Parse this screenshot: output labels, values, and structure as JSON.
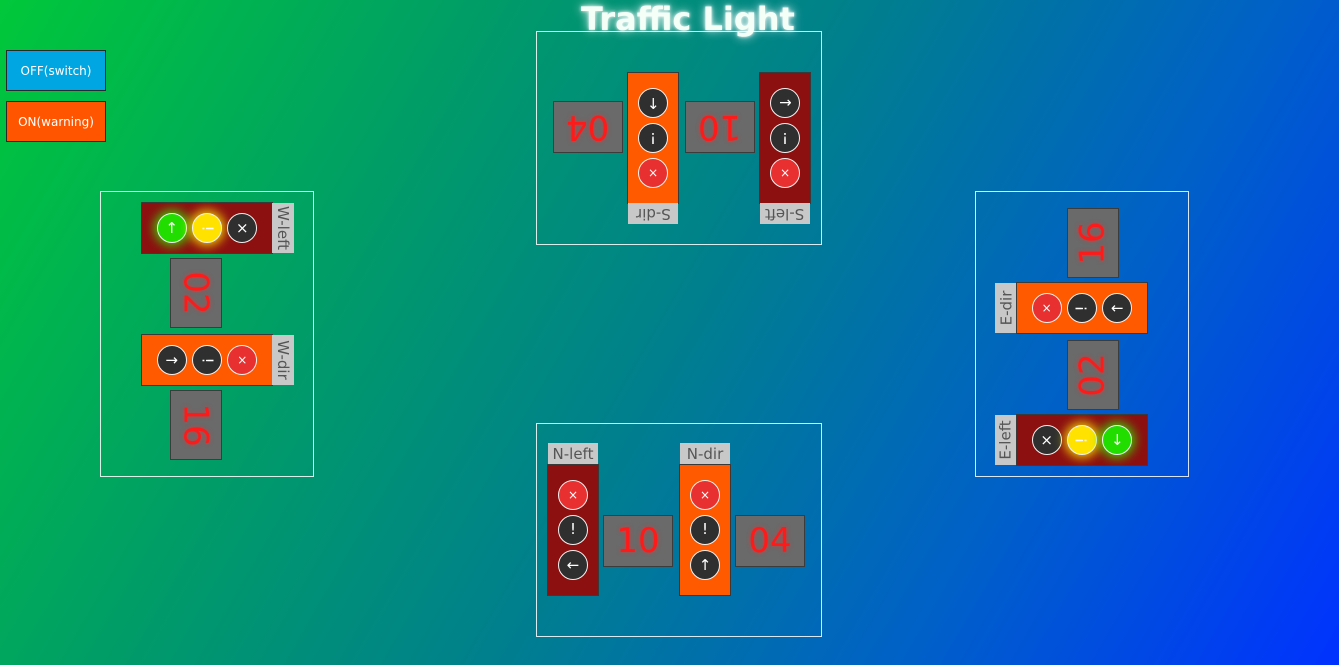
{
  "title": "Traffic Light",
  "controls": {
    "off_label": "OFF(switch)",
    "on_label": "ON(warning)"
  },
  "colors": {
    "background_start": "#00c83a",
    "background_end": "#0032ff",
    "housing_dark": "#8c1010",
    "housing_orange": "#ff5a00",
    "lamp_red": "#e83030",
    "lamp_yellow": "#ffe200",
    "lamp_green": "#22dd00",
    "counter_text": "#ff1a1a",
    "button_off": "#00a6e2",
    "button_on": "#ff5500"
  },
  "south": {
    "dir_label": "S-dir",
    "left_label": "S-left",
    "dir_count": "04",
    "left_count": "10",
    "dir_lamps": [
      {
        "glyph": "↑",
        "state": "off",
        "icon": "arrow-icon"
      },
      {
        "glyph": "!",
        "state": "off",
        "icon": "warning-icon"
      },
      {
        "glyph": "×",
        "state": "red",
        "icon": "stop-icon"
      }
    ],
    "left_lamps": [
      {
        "glyph": "←",
        "state": "off",
        "icon": "arrow-icon"
      },
      {
        "glyph": "!",
        "state": "off",
        "icon": "warning-icon"
      },
      {
        "glyph": "×",
        "state": "red",
        "icon": "stop-icon"
      }
    ]
  },
  "north": {
    "dir_label": "N-dir",
    "left_label": "N-left",
    "dir_count": "04",
    "left_count": "10",
    "dir_lamps": [
      {
        "glyph": "×",
        "state": "red",
        "icon": "stop-icon"
      },
      {
        "glyph": "!",
        "state": "off",
        "icon": "warning-icon"
      },
      {
        "glyph": "↑",
        "state": "off",
        "icon": "arrow-icon"
      }
    ],
    "left_lamps": [
      {
        "glyph": "×",
        "state": "red",
        "icon": "stop-icon"
      },
      {
        "glyph": "!",
        "state": "off",
        "icon": "warning-icon"
      },
      {
        "glyph": "←",
        "state": "off",
        "icon": "arrow-icon"
      }
    ]
  },
  "west": {
    "dir_label": "W-dir",
    "left_label": "W-left",
    "dir_count": "16",
    "left_count": "02",
    "left_lamps": [
      {
        "glyph": "↑",
        "state": "green",
        "icon": "arrow-icon"
      },
      {
        "glyph": "!",
        "state": "yellow",
        "icon": "warning-icon"
      },
      {
        "glyph": "×",
        "state": "off",
        "icon": "stop-icon"
      }
    ],
    "dir_lamps": [
      {
        "glyph": "→",
        "state": "off",
        "icon": "arrow-icon"
      },
      {
        "glyph": "!",
        "state": "off",
        "icon": "warning-icon"
      },
      {
        "glyph": "×",
        "state": "red",
        "icon": "stop-icon"
      }
    ]
  },
  "east": {
    "dir_label": "E-dir",
    "left_label": "E-left",
    "dir_count": "16",
    "left_count": "02",
    "dir_lamps": [
      {
        "glyph": "×",
        "state": "red",
        "icon": "stop-icon"
      },
      {
        "glyph": "!",
        "state": "off",
        "icon": "warning-icon"
      },
      {
        "glyph": "←",
        "state": "off",
        "icon": "arrow-icon"
      }
    ],
    "left_lamps": [
      {
        "glyph": "×",
        "state": "off",
        "icon": "stop-icon"
      },
      {
        "glyph": "!",
        "state": "yellow",
        "icon": "warning-icon"
      },
      {
        "glyph": "↓",
        "state": "green",
        "icon": "arrow-icon"
      }
    ]
  }
}
